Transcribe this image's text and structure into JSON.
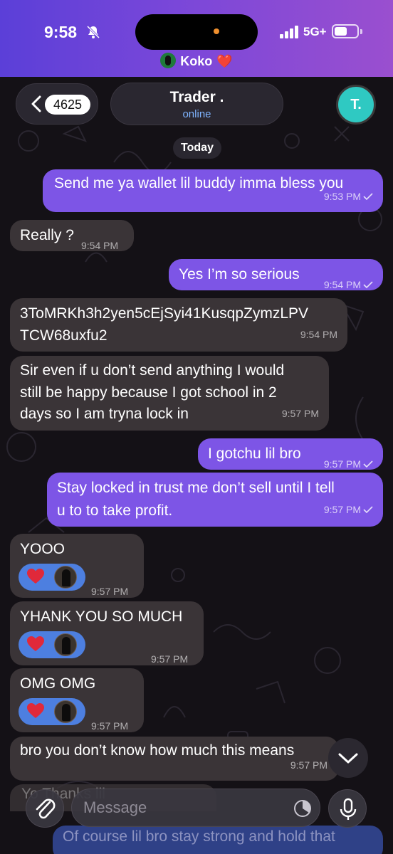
{
  "status_bar": {
    "time": "9:58",
    "network": "5G+",
    "battery_level": 0.55
  },
  "banner": {
    "name": "Koko",
    "emoji": "❤️"
  },
  "header": {
    "back_count": "4625",
    "contact_name": "Trader .",
    "contact_status": "online",
    "avatar_initial": "T."
  },
  "date_divider": "Today",
  "messages": [
    {
      "dir": "out",
      "text": "Send me ya wallet lil buddy imma bless you",
      "time": "9:53 PM"
    },
    {
      "dir": "in",
      "text": "Really ?",
      "time": "9:54 PM"
    },
    {
      "dir": "out",
      "text": "Yes I’m so serious",
      "time": "9:54 PM"
    },
    {
      "dir": "in",
      "lines": [
        "3ToMRKh3h2yen5cEjSyi41KusqpZymzLPV",
        "TCW68uxfu2"
      ],
      "time": "9:54 PM"
    },
    {
      "dir": "in",
      "lines": [
        "Sir even if u don’t send anything I would",
        "still be happy because I got school in 2",
        "days so I am tryna lock in"
      ],
      "time": "9:57 PM"
    },
    {
      "dir": "out",
      "text": "I gotchu lil bro",
      "time": "9:57 PM"
    },
    {
      "dir": "out",
      "lines": [
        "Stay locked in trust me don’t sell until I tell",
        "u to to take profit."
      ],
      "time": "9:57 PM"
    },
    {
      "dir": "in",
      "text": "YOOO",
      "time": "9:57 PM",
      "reaction": "heart"
    },
    {
      "dir": "in",
      "text": "YHANK YOU SO MUCH",
      "time": "9:57 PM",
      "reaction": "heart"
    },
    {
      "dir": "in",
      "text": "OMG OMG",
      "time": "9:57 PM",
      "reaction": "heart"
    },
    {
      "dir": "in",
      "text": "bro you don’t know how much this means",
      "time": "9:57 PM"
    }
  ],
  "partial_incoming": "Yo Thanks lil",
  "partial_outgoing": "Of course lil bro stay strong and hold that",
  "composer": {
    "placeholder": "Message"
  },
  "colors": {
    "outgoing_bubble": "#7d55e6",
    "incoming_bubble": "#3a3437",
    "reaction": "#4d7fe0",
    "avatar": "#2fc9c2"
  }
}
